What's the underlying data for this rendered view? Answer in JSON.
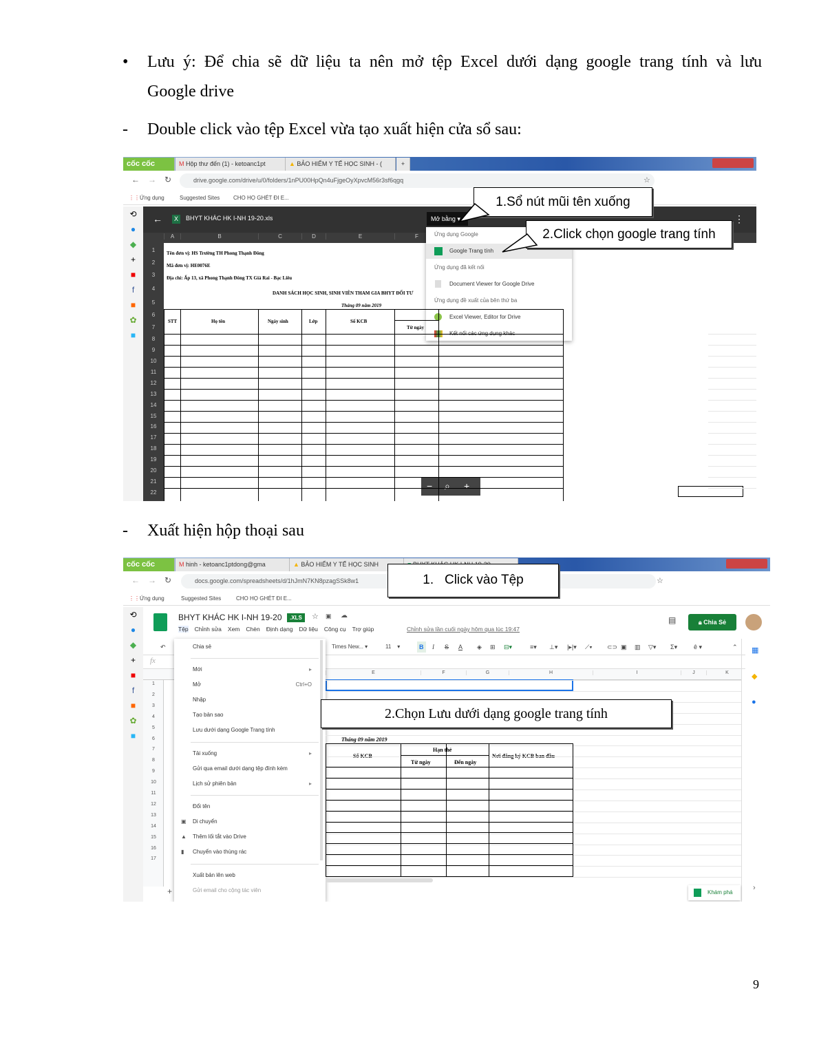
{
  "paragraphs": {
    "note_bullet": "•",
    "note_line1": "Lưu ý: Để chia sẽ dữ liệu ta nên mở tệp Excel dưới dạng google trang tính và lưu",
    "note_line2": "Google drive",
    "step1_dash": "-",
    "step1": "Double click vào tệp Excel vừa tạo xuất hiện cửa sổ sau:",
    "step2_dash": "-",
    "step2": "Xuất hiện hộp thoại sau"
  },
  "page_number": "9",
  "shot1": {
    "tabs": [
      "cốc cốc",
      "Hộp thư đến (1) - ketoanc1pt",
      "BẢO HIỂM Y TẾ HỌC SINH - ("
    ],
    "url": "drive.google.com/drive/u/0/folders/1nPU00HpQn4uFjgeOyXpvcM56r3sf6qgq",
    "bookmarks": [
      "Ứng dụng",
      "Suggested Sites",
      "CHO HỌ GHÉT ĐI E..."
    ],
    "file_name": "BHYT KHÁC HK I-NH 19-20.xls",
    "open_with": "Mở bằng",
    "columns": [
      "A",
      "B",
      "C",
      "D",
      "E",
      "F"
    ],
    "rows": [
      "1",
      "2",
      "3",
      "4",
      "5",
      "6",
      "7",
      "8",
      "9",
      "10",
      "11",
      "12",
      "13",
      "14",
      "15",
      "16",
      "17",
      "18",
      "19",
      "20",
      "21",
      "22"
    ],
    "cells": {
      "unit": "Tên đơn vị: HS Trường TH Phong Thạnh Đông",
      "code": "Mã đơn vị: HE0076E",
      "address": "Địa chỉ: Ấp 13, xã Phong Thạnh Đông  TX Giá Rai - Bạc Liêu",
      "title": "DANH SÁCH HỌC SINH, SINH VIÊN THAM GIA BHYT ĐỐI TƯ",
      "month": "Tháng 09 năm 2019",
      "h_stt": "STT",
      "h_name": "Họ tên",
      "h_dob": "Ngày sinh",
      "h_class": "Lớp",
      "h_kcb": "Số KCB",
      "h_from": "Từ ngày"
    },
    "menu": {
      "section1": "Ứng dụng Google",
      "item1": "Google Trang tính",
      "section2": "Ứng dụng đã kết nối",
      "item2": "Document Viewer for Google Drive",
      "section3": "Ứng dụng đề xuất của bên thứ ba",
      "item3": "Excel Viewer, Editor for Drive",
      "item4": "Kết nối các ứng dụng khác"
    },
    "callout1": "1.Sổ nút mũi tên xuống",
    "callout2": "2.Click chọn google trang tính",
    "zoom_minus": "−",
    "zoom_icon": "⌕",
    "zoom_plus": "+"
  },
  "shot2": {
    "tabs": [
      "cốc cốc",
      "hinh - ketoanc1ptdong@gma",
      "BẢO HIỂM Y TẾ HỌC SINH",
      "BHYT KHÁC HK I-NH 19-20"
    ],
    "url": "docs.google.com/spreadsheets/d/1hJmN7KN8pzagSSk8w1",
    "bookmarks": [
      "Ứng dụng",
      "Suggested Sites",
      "CHO HỌ GHÉT ĐI E..."
    ],
    "doc_title": "BHYT KHÁC HK I-NH 19-20",
    "badge": ".XLS",
    "menus": [
      "Tệp",
      "Chỉnh sửa",
      "Xem",
      "Chèn",
      "Định dạng",
      "Dữ liệu",
      "Công cụ",
      "Trợ giúp"
    ],
    "last_edit": "Chỉnh sửa lần cuối ngày hôm qua lúc 19:47",
    "share": "Chia Sẻ",
    "font": "Times New...",
    "font_size": "11",
    "fx": "fx",
    "columns": [
      "E",
      "F",
      "G",
      "H",
      "I",
      "J",
      "K"
    ],
    "rows": [
      "1",
      "2",
      "3",
      "4",
      "5",
      "6",
      "7",
      "8",
      "9",
      "10",
      "11",
      "12",
      "13",
      "14",
      "15",
      "16",
      "17"
    ],
    "cells": {
      "month": "Tháng 09 năm 2019",
      "kcb": "Số KCB",
      "han_the": "Hạn thẻ",
      "from": "Từ ngày",
      "to": "Đến ngày",
      "place": "Nơi đăng ký KCB ban đầu"
    },
    "file_menu": [
      {
        "label": "Chia sẻ"
      },
      {
        "label": "Mới",
        "arrow": "▸"
      },
      {
        "label": "Mở",
        "shortcut": "Ctrl+O"
      },
      {
        "label": "Nhập"
      },
      {
        "label": "Tạo bản sao"
      },
      {
        "label": "Lưu dưới dạng Google Trang tính"
      },
      {
        "label": "Tải xuống",
        "arrow": "▸"
      },
      {
        "label": "Gửi qua email dưới dạng tệp đính kèm"
      },
      {
        "label": "Lịch sử phiên bản",
        "arrow": "▸"
      },
      {
        "label": "Đổi tên"
      },
      {
        "label": "Di chuyển"
      },
      {
        "label": "Thêm lối tắt vào Drive"
      },
      {
        "label": "Chuyển vào thùng rác"
      },
      {
        "label": "Xuất bản lên web"
      },
      {
        "label": "Gửi email cho cộng tác viên"
      }
    ],
    "explore": "Khám phá",
    "callout1_num": "1.",
    "callout1": "Click vào Tệp",
    "callout2": "2.Chọn Lưu dưới dạng google trang tính"
  },
  "colors": {
    "sheets_green": "#188038",
    "coccoc_green": "#7cc242",
    "drive_dark": "#323232",
    "select_blue": "#1a73e8"
  }
}
